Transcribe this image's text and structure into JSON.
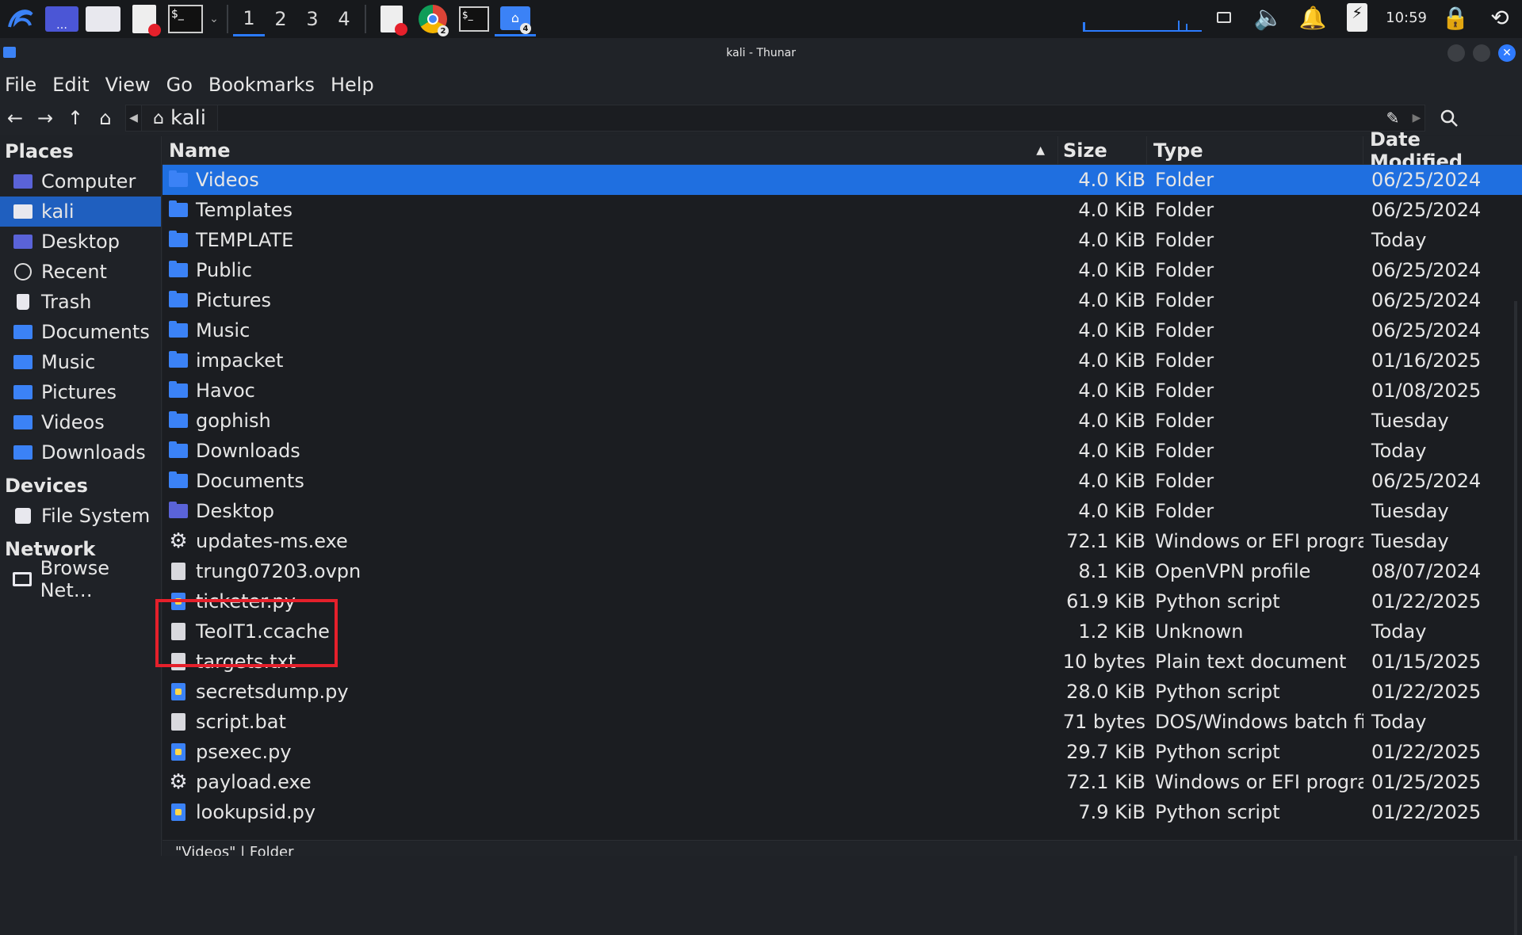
{
  "taskbar": {
    "workspaces": [
      "1",
      "2",
      "3",
      "4"
    ],
    "clock": "10:59",
    "chrome_badge": "2",
    "files_badge": "4"
  },
  "window": {
    "title": "kali - Thunar"
  },
  "menu": [
    "File",
    "Edit",
    "View",
    "Go",
    "Bookmarks",
    "Help"
  ],
  "path": {
    "current": "kali"
  },
  "sidebar": {
    "places_heading": "Places",
    "places": [
      {
        "label": "Computer",
        "icon": "computer-icon"
      },
      {
        "label": "kali",
        "icon": "home-folder-icon"
      },
      {
        "label": "Desktop",
        "icon": "desktop-folder-icon"
      },
      {
        "label": "Recent",
        "icon": "recent-icon"
      },
      {
        "label": "Trash",
        "icon": "trash-icon"
      },
      {
        "label": "Documents",
        "icon": "documents-folder-icon"
      },
      {
        "label": "Music",
        "icon": "music-folder-icon"
      },
      {
        "label": "Pictures",
        "icon": "pictures-folder-icon"
      },
      {
        "label": "Videos",
        "icon": "videos-folder-icon"
      },
      {
        "label": "Downloads",
        "icon": "downloads-folder-icon"
      }
    ],
    "devices_heading": "Devices",
    "devices": [
      {
        "label": "File System",
        "icon": "drive-icon"
      }
    ],
    "network_heading": "Network",
    "network": [
      {
        "label": "Browse Net…",
        "icon": "network-icon"
      }
    ]
  },
  "columns": {
    "name": "Name",
    "size": "Size",
    "type": "Type",
    "date": "Date Modified"
  },
  "files": [
    {
      "name": "Videos",
      "size": "4.0 KiB",
      "type": "Folder",
      "date": "06/25/2024",
      "kind": "folder"
    },
    {
      "name": "Templates",
      "size": "4.0 KiB",
      "type": "Folder",
      "date": "06/25/2024",
      "kind": "folder"
    },
    {
      "name": "TEMPLATE",
      "size": "4.0 KiB",
      "type": "Folder",
      "date": "Today",
      "kind": "folder"
    },
    {
      "name": "Public",
      "size": "4.0 KiB",
      "type": "Folder",
      "date": "06/25/2024",
      "kind": "folder"
    },
    {
      "name": "Pictures",
      "size": "4.0 KiB",
      "type": "Folder",
      "date": "06/25/2024",
      "kind": "folder"
    },
    {
      "name": "Music",
      "size": "4.0 KiB",
      "type": "Folder",
      "date": "06/25/2024",
      "kind": "folder"
    },
    {
      "name": "impacket",
      "size": "4.0 KiB",
      "type": "Folder",
      "date": "01/16/2025",
      "kind": "folder"
    },
    {
      "name": "Havoc",
      "size": "4.0 KiB",
      "type": "Folder",
      "date": "01/08/2025",
      "kind": "folder"
    },
    {
      "name": "gophish",
      "size": "4.0 KiB",
      "type": "Folder",
      "date": "Tuesday",
      "kind": "folder"
    },
    {
      "name": "Downloads",
      "size": "4.0 KiB",
      "type": "Folder",
      "date": "Today",
      "kind": "folder"
    },
    {
      "name": "Documents",
      "size": "4.0 KiB",
      "type": "Folder",
      "date": "06/25/2024",
      "kind": "folder"
    },
    {
      "name": "Desktop",
      "size": "4.0 KiB",
      "type": "Folder",
      "date": "Tuesday",
      "kind": "folder-purple"
    },
    {
      "name": "updates-ms.exe",
      "size": "72.1 KiB",
      "type": "Windows or EFI program",
      "date": "Tuesday",
      "kind": "exe"
    },
    {
      "name": "trung07203.ovpn",
      "size": "8.1 KiB",
      "type": "OpenVPN profile",
      "date": "08/07/2024",
      "kind": "doc"
    },
    {
      "name": "ticketer.py",
      "size": "61.9 KiB",
      "type": "Python script",
      "date": "01/22/2025",
      "kind": "py"
    },
    {
      "name": "TeoIT1.ccache",
      "size": "1.2 KiB",
      "type": "Unknown",
      "date": "Today",
      "kind": "doc"
    },
    {
      "name": "targets.txt",
      "size": "10 bytes",
      "type": "Plain text document",
      "date": "01/15/2025",
      "kind": "doc"
    },
    {
      "name": "secretsdump.py",
      "size": "28.0 KiB",
      "type": "Python script",
      "date": "01/22/2025",
      "kind": "py"
    },
    {
      "name": "script.bat",
      "size": "71 bytes",
      "type": "DOS/Windows batch file",
      "date": "Today",
      "kind": "doc"
    },
    {
      "name": "psexec.py",
      "size": "29.7 KiB",
      "type": "Python script",
      "date": "01/22/2025",
      "kind": "py"
    },
    {
      "name": "payload.exe",
      "size": "72.1 KiB",
      "type": "Windows or EFI program",
      "date": "01/25/2025",
      "kind": "exe"
    },
    {
      "name": "lookupsid.py",
      "size": "7.9 KiB",
      "type": "Python script",
      "date": "01/22/2025",
      "kind": "py"
    }
  ],
  "status": "\"Videos\" | Folder"
}
